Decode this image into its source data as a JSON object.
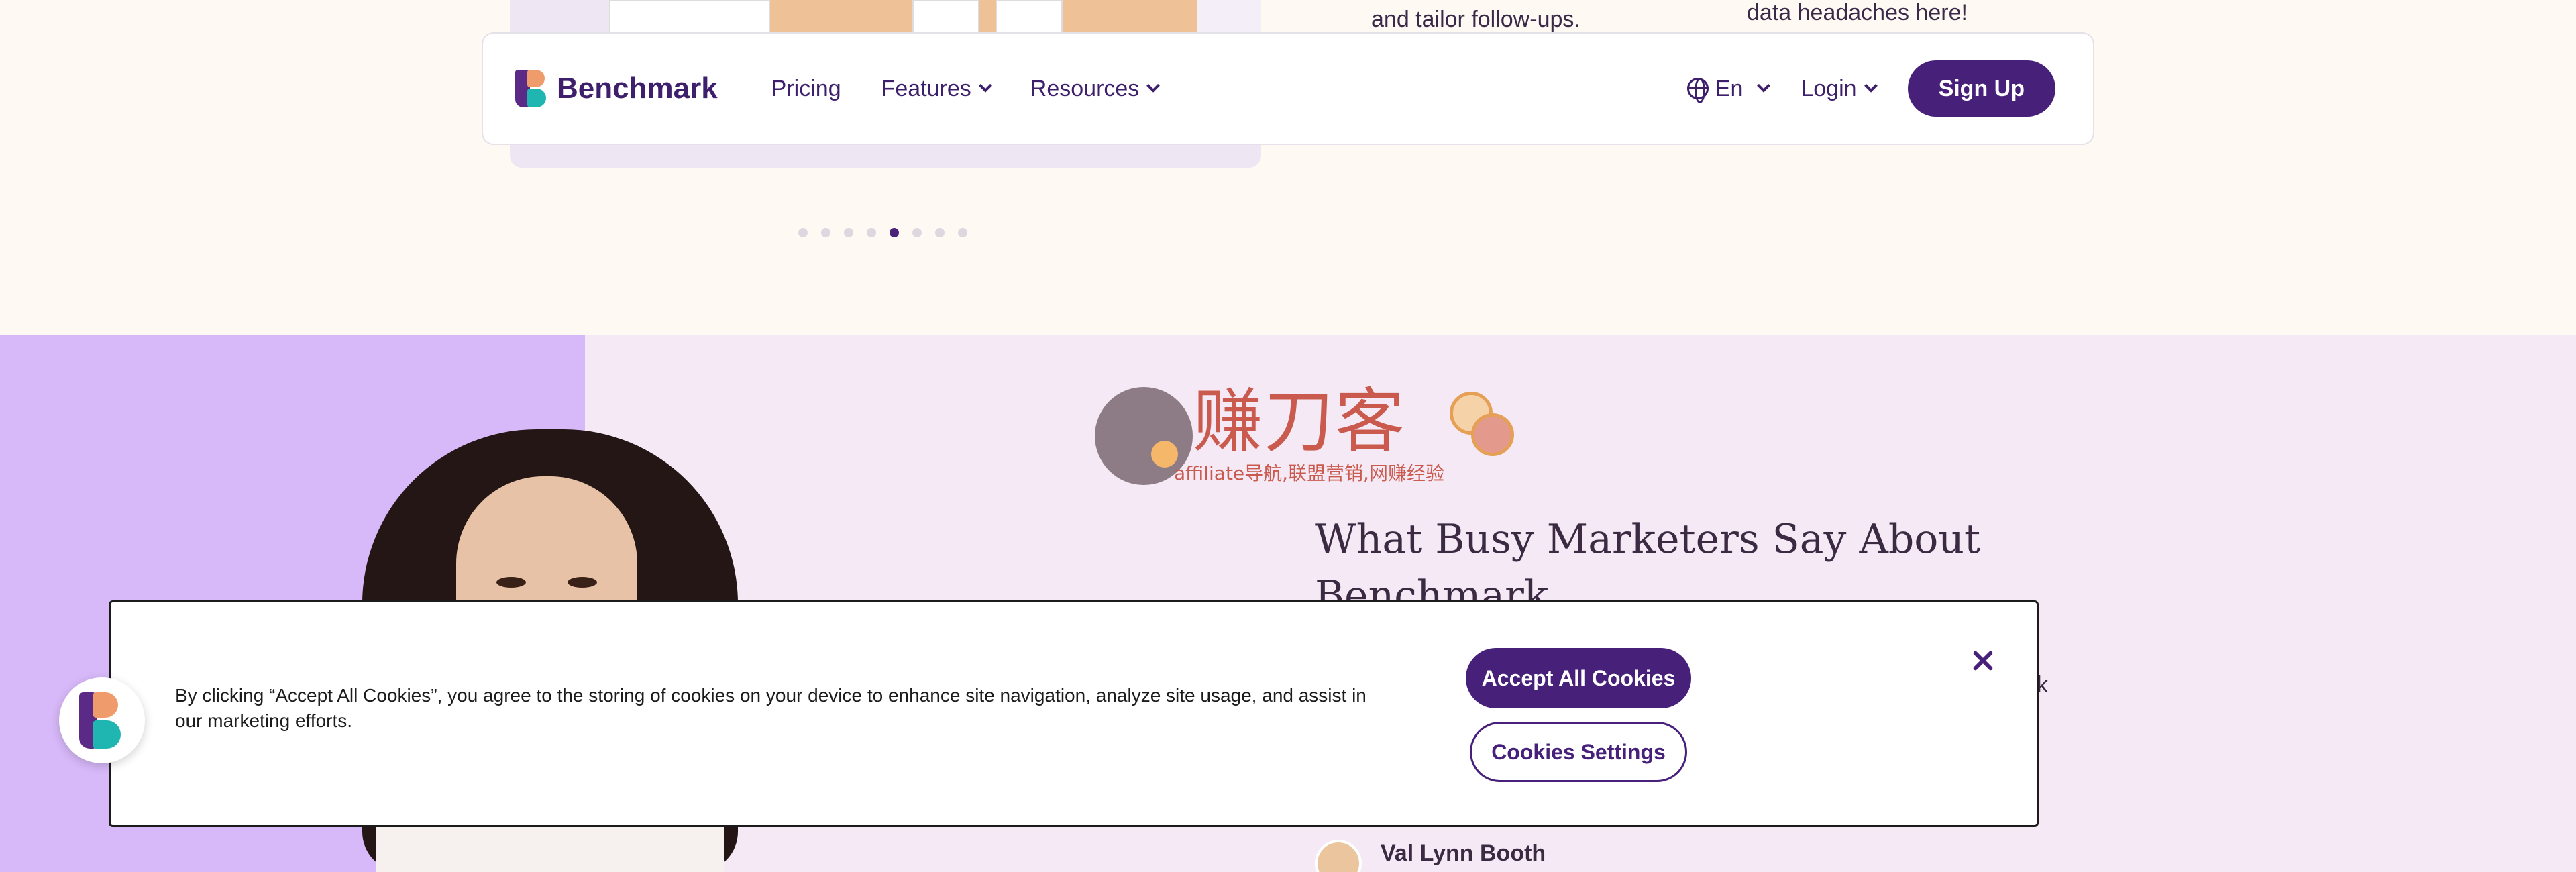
{
  "carousel": {
    "feature_text_1": "and tailor follow-ups.",
    "feature_text_2": "data headaches here!",
    "slide_count": 8,
    "active_slide": 5
  },
  "navbar": {
    "brand": "Benchmark",
    "links": [
      {
        "label": "Pricing",
        "has_dropdown": false
      },
      {
        "label": "Features",
        "has_dropdown": true
      },
      {
        "label": "Resources",
        "has_dropdown": true
      }
    ],
    "language": "En",
    "login": "Login",
    "signup": "Sign Up"
  },
  "watermark": {
    "title": "赚刀客",
    "subtitle": "affiliate导航,联盟营销,网赚经验"
  },
  "testimonials": {
    "title": "What Busy Marketers Say About Benchmark",
    "trailing_fragment": "k",
    "person_name": "Val Lynn Booth"
  },
  "cookie_banner": {
    "text": "By clicking “Accept All Cookies”, you agree to the storing of cookies on your device to enhance site navigation, analyze site usage, and assist in our marketing efforts.",
    "accept_label": "Accept All Cookies",
    "settings_label": "Cookies Settings"
  },
  "colors": {
    "brand_purple": "#47207a",
    "cream": "#fef9f3",
    "lavender": "#d7b8f8",
    "section_pink": "#f4e9f5"
  }
}
